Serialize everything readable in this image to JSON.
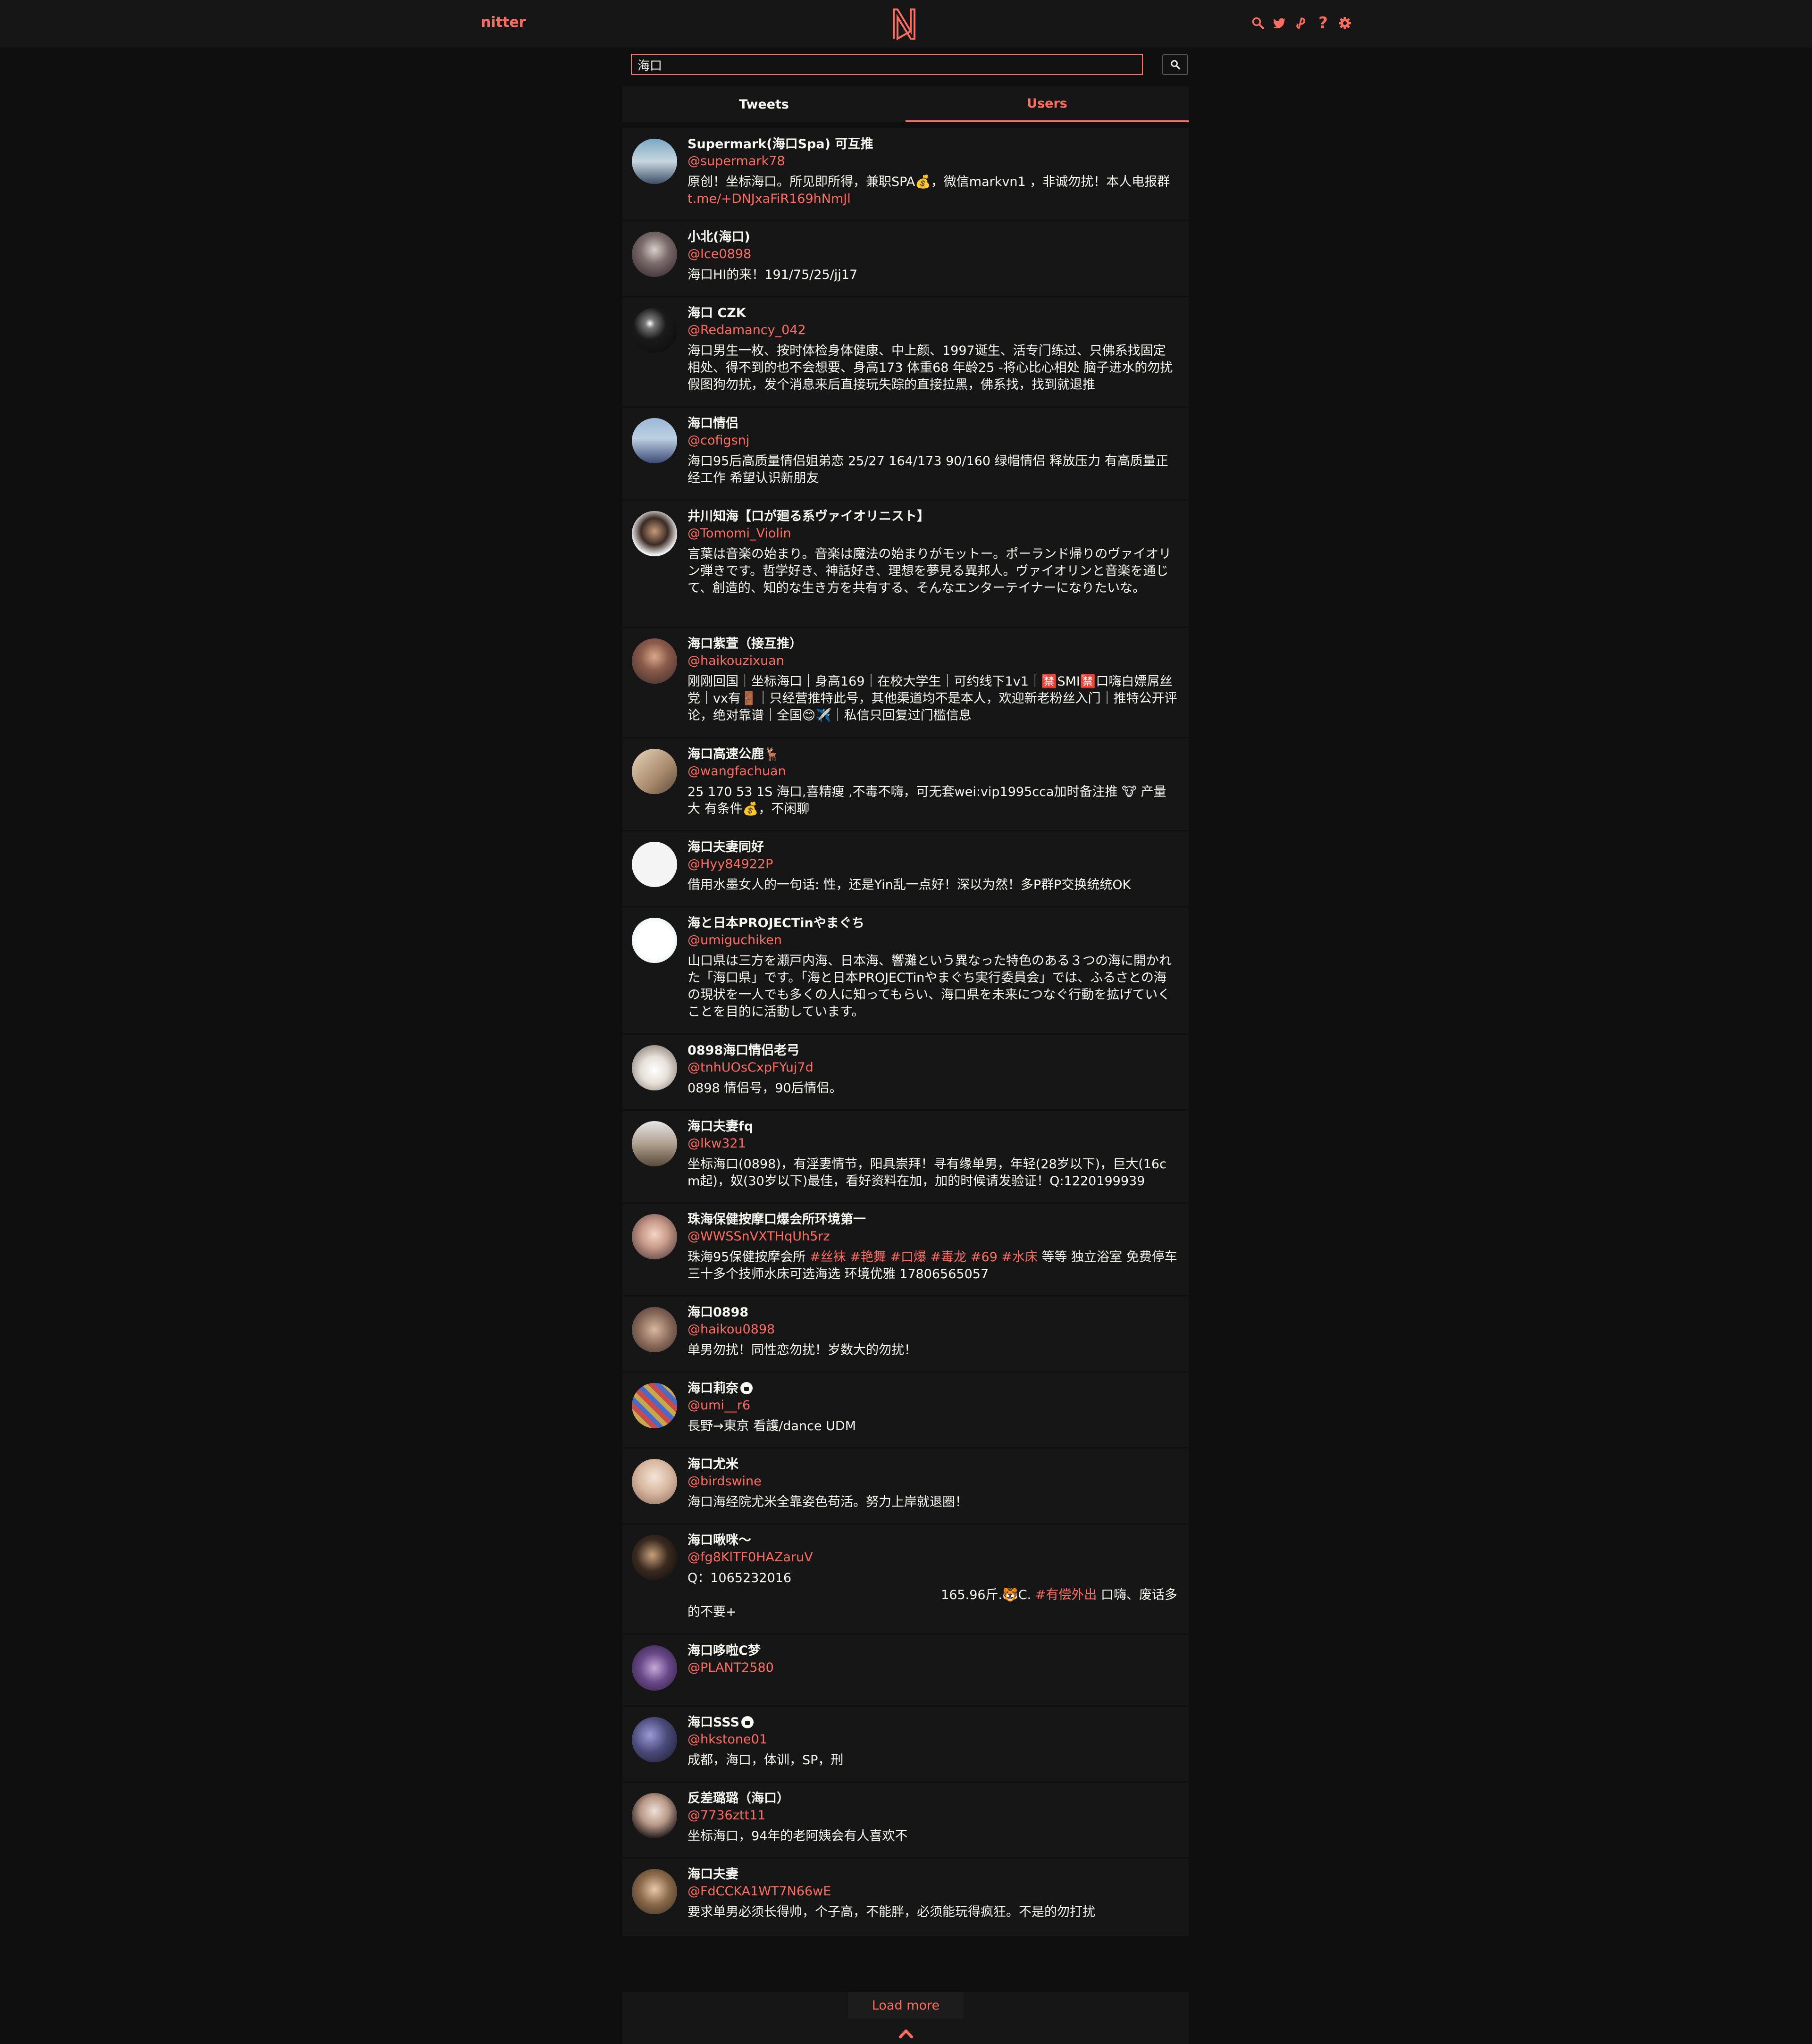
{
  "nav": {
    "brand": "nitter",
    "logo_letter": "N",
    "help_glyph": "?"
  },
  "search": {
    "value": "海口"
  },
  "tabs": [
    {
      "label": "Tweets",
      "active": false
    },
    {
      "label": "Users",
      "active": true
    }
  ],
  "accent_color": "#ff6c60",
  "users": [
    {
      "name": "Supermark(海口Spa) 可互推",
      "handle": "@supermark78",
      "bio": "原创！坐标海口。所见即所得，兼职SPA💰，微信markvn1 ，非诚勿扰！本人电报群",
      "link": "t.me/+DNJxaFiR169hNmJl"
    },
    {
      "name": "小北(海口)",
      "handle": "@Ice0898",
      "bio": "海口HI的来！191/75/25/jj17"
    },
    {
      "name": "海口 CZK",
      "handle": "@Redamancy_042",
      "bio": "海口男生一枚、按时体检身体健康、中上颜、1997诞生、活专门练过、只佛系找固定相处、得不到的也不会想要、身高173 体重68 年龄25 -将心比心相处 脑子进水的勿扰 假图狗勿扰，发个消息来后直接玩失踪的直接拉黑，佛系找，找到就退推"
    },
    {
      "name": "海口情侣",
      "handle": "@cofigsnj",
      "bio": "海口95后高质量情侣姐弟恋 25/27 164/173 90/160 绿帽情侣 释放压力 有高质量正经工作 希望认识新朋友"
    },
    {
      "name": "井川知海【口が廻る系ヴァイオリニスト】",
      "handle": "@Tomomi_Violin",
      "bio": "言葉は音楽の始まり。音楽は魔法の始まりがモットー。ポーランド帰りのヴァイオリン弾きです。哲学好き、神話好き、理想を夢見る異邦人。ヴァイオリンと音楽を通じて、創造的、知的な生き方を共有する、そんなエンターテイナーになりたいな。"
    },
    {
      "name": "海口紫萱（接互推）",
      "handle": "@haikouzixuan",
      "bio": "刚刚回国｜坐标海口｜身高169｜在校大学生｜可约线下1v1｜🈲SMI🈲口嗨白嫖屌丝党｜vx有🚪｜只经营推特此号，其他渠道均不是本人，欢迎新老粉丝入门｜推特公开评论，绝对靠谱｜全国😊✈️｜私信只回复过门槛信息"
    },
    {
      "name": "海口高速公鹿🦌",
      "handle": "@wangfachuan",
      "bio": "25 170 53 1S 海口,喜精瘦 ,不毒不嗨，可无套wei:vip1995cca加时备注推 🐮 产量大 有条件💰，不闲聊"
    },
    {
      "name": "海口夫妻同好",
      "handle": "@Hyy84922P",
      "bio": "借用水墨女人的一句话: 性，还是Yin乱一点好！深以为然！多P群P交换统统OK"
    },
    {
      "name": "海と日本PROJECTinやまぐち",
      "handle": "@umiguchiken",
      "bio": "山口県は三方を瀬戸内海、日本海、響灘という異なった特色のある３つの海に開かれた「海口県」です。「海と日本PROJECTinやまぐち実行委員会」では、ふるさとの海の現状を一人でも多くの人に知ってもらい、海口県を未来につなぐ行動を拡げていくことを目的に活動しています。"
    },
    {
      "name": "0898海口情侣老弓",
      "handle": "@tnhUOsCxpFYuj7d",
      "bio": "0898 情侣号，90后情侣。"
    },
    {
      "name": "海口夫妻fq",
      "handle": "@lkw321",
      "bio": "坐标海口(0898)，有淫妻情节，阳具崇拜！寻有缘单男，年轻(28岁以下)，巨大(16cm起)，奴(30岁以下)最佳，看好资料在加，加的时候请发验证！Q:1220199939"
    },
    {
      "name": "珠海保健按摩口爆会所环境第一",
      "handle": "@WWSSnVXTHqUh5rz",
      "bio_pre": "珠海95保健按摩会所 ",
      "bio_tags": "#丝袜 #艳舞 #口爆 #毒龙 #69 #水床",
      "bio_post": " 等等 独立浴室 免费停车 三十多个技师水床可选海选 环境优雅 17806565057"
    },
    {
      "name": "海口0898",
      "handle": "@haikou0898",
      "bio": "单男勿扰！同性恋勿扰！岁数大的勿扰！"
    },
    {
      "name": "海口莉奈",
      "handle": "@umi__r6",
      "bio": "長野→東京 看護/dance UDM"
    },
    {
      "name": "海口尤米",
      "handle": "@birdswine",
      "bio": "海口海经院尤米全靠姿色苟活。努力上岸就退圈！"
    },
    {
      "name": "海口啾咪～",
      "handle": "@fg8KlTF0HAZaruV",
      "bio_line1": "Q：1065232016",
      "bio_line2_pre": "165.96斤.🐯C. ",
      "bio_line2_tag": "#有偿外出",
      "bio_line2_post": " 口嗨、废话多",
      "bio_line3": "的不要+"
    },
    {
      "name": "海口哆啦C梦",
      "handle": "@PLANT2580",
      "bio": ""
    },
    {
      "name": "海口SSS",
      "handle": "@hkstone01",
      "bio": "成都，海口，体训，SP，刑"
    },
    {
      "name": "反差璐璐（海口）",
      "handle": "@7736ztt11",
      "bio": "坐标海口，94年的老阿姨会有人喜欢不"
    },
    {
      "name": "海口夫妻",
      "handle": "@FdCCKA1WT7N66wE",
      "bio": "要求单男必须长得帅，个子高，不能胖，必须能玩得疯狂。不是的勿打扰"
    }
  ],
  "load_more": "Load more"
}
